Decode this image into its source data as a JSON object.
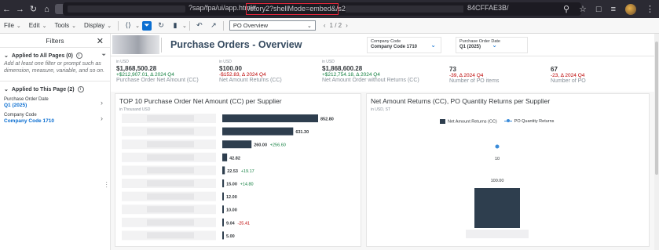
{
  "browser": {
    "url_mid": "?sap/fpa/ui/app.html#",
    "url_highlight": "/story2?shellMode=embed&/s2/",
    "url_tail": "84CFFAE3B/"
  },
  "toolbar": {
    "file": "File",
    "edit": "Edit",
    "tools": "Tools",
    "display": "Display",
    "page_select": "PO Overview",
    "page_indicator": "1 / 2"
  },
  "filters_panel": {
    "title": "Filters",
    "all_pages_title": "Applied to All Pages (0)",
    "all_pages_note": "Add at least one filter or prompt such as dimension, measure, variable, and so on.",
    "this_page_title": "Applied to This Page (2)",
    "items": [
      {
        "label": "Purchase Order Date",
        "value": "Q1 (2025)"
      },
      {
        "label": "Company Code",
        "value": "Company Code 1710"
      }
    ]
  },
  "header": {
    "title": "Purchase Orders - Overview",
    "filters": [
      {
        "label": "Company Code",
        "value": "Company Code 1710"
      },
      {
        "label": "Purchase Order Date",
        "value": "Q1 (2025)"
      }
    ]
  },
  "kpis": [
    {
      "unit": "in USD",
      "value": "$1,868,500.28",
      "delta": "+$212,907.01, Δ 2024 Q4",
      "delta_dir": "pos",
      "label": "Purchase Order Net Amount (CC)"
    },
    {
      "unit": "in USD",
      "value": "$100.00",
      "delta": "-$152.83, Δ 2024 Q4",
      "delta_dir": "neg",
      "label": "Net Amount Returns (CC)"
    },
    {
      "unit": "in USD",
      "value": "$1,868,600.28",
      "delta": "+$212,754.18, Δ 2024 Q4",
      "delta_dir": "pos",
      "label": "Net Amount Order without Returns (CC)"
    },
    {
      "unit": "",
      "value": "73",
      "delta": "-39, Δ 2024 Q4",
      "delta_dir": "neg",
      "label": "Number of PO items"
    },
    {
      "unit": "",
      "value": "67",
      "delta": "-23, Δ 2024 Q4",
      "delta_dir": "neg",
      "label": "Number of PO"
    }
  ],
  "charts": {
    "left": {
      "title": "TOP 10 Purchase Order Net Amount (CC) per Supplier",
      "subtitle": "in Thousand USD"
    },
    "right": {
      "title": "Net Amount Returns (CC), PO Quantity Returns per Supplier",
      "subtitle": "in USD, ST"
    }
  },
  "chart_data": [
    {
      "type": "bar",
      "orientation": "horizontal",
      "title": "TOP 10 Purchase Order Net Amount (CC) per Supplier",
      "subtitle": "in Thousand USD",
      "values": [
        852.8,
        631.3,
        260.0,
        42.82,
        22.53,
        15.0,
        12.0,
        10.0,
        9.04,
        5.0
      ],
      "value_labels": [
        "852.80",
        "631.30",
        "260.00",
        "42.82",
        "22.53",
        "15.00",
        "12.00",
        "10.00",
        "9.04",
        "5.00"
      ],
      "variance_labels": [
        "",
        "",
        "+256.60",
        "",
        "+19.17",
        "+14.80",
        "",
        "",
        "-25.41",
        ""
      ],
      "variance_colors": [
        "",
        "",
        "#107e3e",
        "",
        "#107e3e",
        "#107e3e",
        "",
        "",
        "#bb0000",
        ""
      ],
      "bar_color": "#2e3e4e"
    },
    {
      "type": "bar",
      "title": "Net Amount Returns (CC), PO Quantity Returns per Supplier",
      "subtitle": "in USD, ST",
      "legend": [
        "Net Amount Returns (CC)",
        "PO Quantity Returns"
      ],
      "series": [
        {
          "name": "Net Amount Returns (CC)",
          "values": [
            100.0
          ],
          "labels": [
            "100.00"
          ],
          "color": "#2e3e4e"
        },
        {
          "name": "PO Quantity Returns",
          "values": [
            10
          ],
          "labels": [
            "10"
          ],
          "color": "#3a8bd9"
        }
      ]
    }
  ]
}
